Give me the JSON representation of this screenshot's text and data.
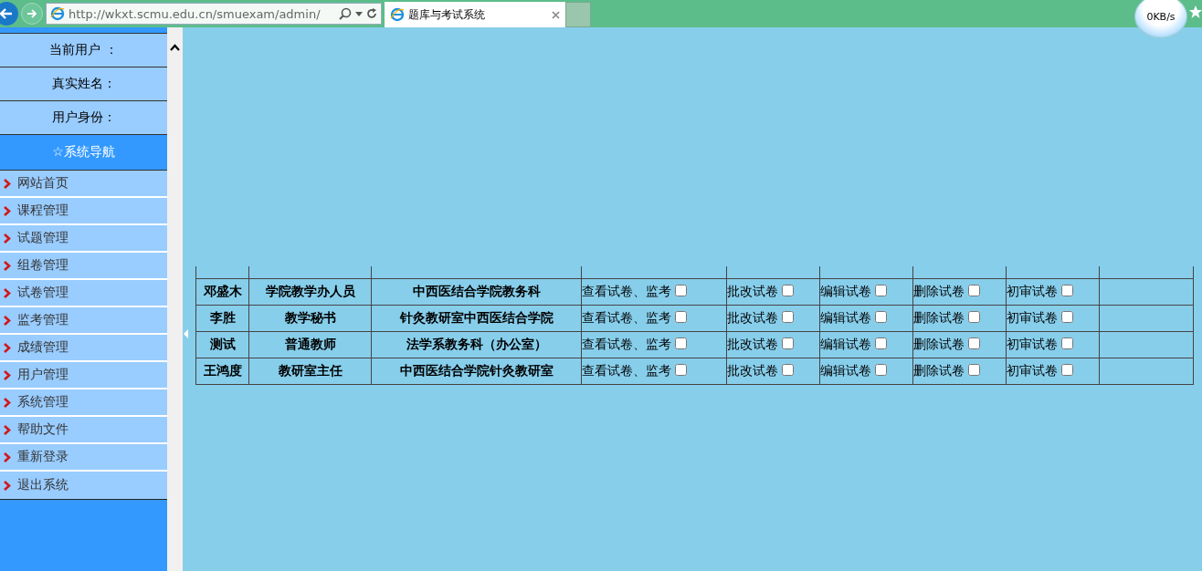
{
  "browser": {
    "url": "http://wkxt.scmu.edu.cn/smuexam/admin/",
    "tab_title": "题库与考试系统",
    "net_speed": "0KB/s"
  },
  "sidebar": {
    "user_fields": [
      "当前用户 ：",
      "真实姓名：",
      "用户身份："
    ],
    "nav_title": "☆系统导航",
    "items": [
      "网站首页",
      "课程管理",
      "试题管理",
      "组卷管理",
      "试卷管理",
      "监考管理",
      "成绩管理",
      "用户管理",
      "系统管理",
      "帮助文件",
      "重新登录",
      "退出系统"
    ]
  },
  "table": {
    "rows": [
      {
        "name": "邓盛木",
        "role": "学院教学办人员",
        "department": "中西医结合学院教务科",
        "permissions": [
          {
            "label": "查看试卷、监考",
            "checked": false
          },
          {
            "label": "批改试卷",
            "checked": false
          },
          {
            "label": "编辑试卷",
            "checked": false
          },
          {
            "label": "删除试卷",
            "checked": false
          },
          {
            "label": "初审试卷",
            "checked": false
          }
        ]
      },
      {
        "name": "李胜",
        "role": "教学秘书",
        "department": "针灸教研室中西医结合学院",
        "permissions": [
          {
            "label": "查看试卷、监考",
            "checked": false
          },
          {
            "label": "批改试卷",
            "checked": false
          },
          {
            "label": "编辑试卷",
            "checked": false
          },
          {
            "label": "删除试卷",
            "checked": false
          },
          {
            "label": "初审试卷",
            "checked": false
          }
        ]
      },
      {
        "name": "测试",
        "role": "普通教师",
        "department": "法学系教务科（办公室）",
        "permissions": [
          {
            "label": "查看试卷、监考",
            "checked": false
          },
          {
            "label": "批改试卷",
            "checked": false
          },
          {
            "label": "编辑试卷",
            "checked": false
          },
          {
            "label": "删除试卷",
            "checked": false
          },
          {
            "label": "初审试卷",
            "checked": false
          }
        ]
      },
      {
        "name": "王鸿度",
        "role": "教研室主任",
        "department": "中西医结合学院针灸教研室",
        "permissions": [
          {
            "label": "查看试卷、监考",
            "checked": false
          },
          {
            "label": "批改试卷",
            "checked": false
          },
          {
            "label": "编辑试卷",
            "checked": false
          },
          {
            "label": "删除试卷",
            "checked": false
          },
          {
            "label": "初审试卷",
            "checked": false
          }
        ]
      }
    ]
  }
}
